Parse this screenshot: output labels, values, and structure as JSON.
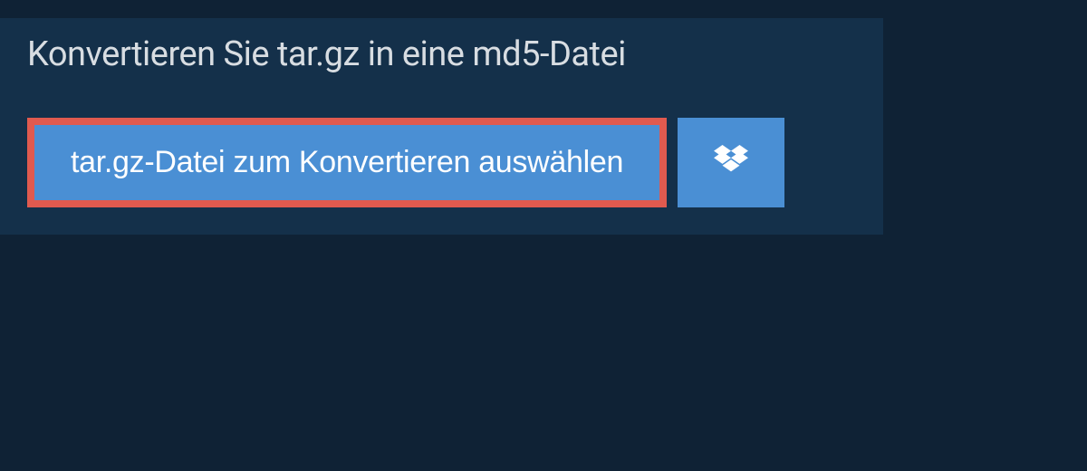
{
  "title": "Konvertieren Sie tar.gz in eine md5-Datei",
  "select_button_label": "tar.gz-Datei zum Konvertieren auswählen",
  "colors": {
    "page_bg": "#0f2235",
    "panel_bg": "#14304a",
    "button_bg": "#4a8fd4",
    "highlight_border": "#e05a4f",
    "text_light": "#d8dde2"
  }
}
